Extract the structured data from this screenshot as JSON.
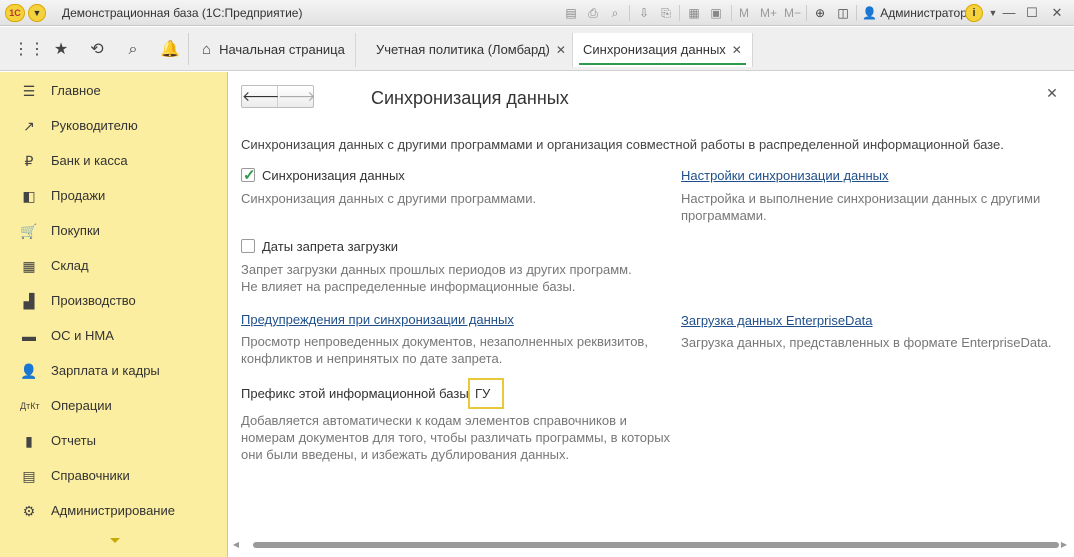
{
  "window": {
    "logo": "1С",
    "title": "Демонстрационная база  (1С:Предприятие)",
    "toolbar_m": "M",
    "toolbar_mplus": "M+",
    "toolbar_mminus": "M−",
    "user": "Администратор",
    "info": "i"
  },
  "tabs": {
    "home": "Начальная страница",
    "accounting_policy": "Учетная политика (Ломбард)",
    "sync": "Синхронизация данных"
  },
  "sidebar": {
    "items": [
      {
        "label": "Главное",
        "icon": "menu-icon"
      },
      {
        "label": "Руководителю",
        "icon": "trend-icon"
      },
      {
        "label": "Банк и касса",
        "icon": "ruble-icon"
      },
      {
        "label": "Продажи",
        "icon": "bag-icon"
      },
      {
        "label": "Покупки",
        "icon": "cart-icon"
      },
      {
        "label": "Склад",
        "icon": "warehouse-icon"
      },
      {
        "label": "Производство",
        "icon": "factory-icon"
      },
      {
        "label": "ОС и НМА",
        "icon": "assets-icon"
      },
      {
        "label": "Зарплата и кадры",
        "icon": "person-icon"
      },
      {
        "label": "Операции",
        "icon": "debit-credit-icon"
      },
      {
        "label": "Отчеты",
        "icon": "chart-icon"
      },
      {
        "label": "Справочники",
        "icon": "book-icon"
      },
      {
        "label": "Администрирование",
        "icon": "gear-icon"
      }
    ]
  },
  "form": {
    "title": "Синхронизация данных",
    "intro": "Синхронизация данных с другими программами и организация совместной работы в распределенной информационной базе.",
    "sync_checkbox": {
      "label": "Синхронизация данных",
      "checked": true,
      "desc": "Синхронизация данных с другими программами."
    },
    "settings_link": {
      "label": "Настройки синхронизации данных",
      "desc_1": "Настройка и выполнение синхронизации данных с другими",
      "desc_2": "программами."
    },
    "lock_checkbox": {
      "label": "Даты запрета загрузки",
      "checked": false,
      "desc_1": "Запрет загрузки данных прошлых периодов из других программ.",
      "desc_2": "Не влияет на распределенные информационные базы."
    },
    "warnings_link": {
      "label": "Предупреждения при синхронизации данных",
      "desc_1": "Просмотр непроведенных документов, незаполненных реквизитов,",
      "desc_2": "конфликтов и непринятых по дате запрета."
    },
    "enterprise_link": {
      "label": "Загрузка данных EnterpriseData",
      "desc": "Загрузка данных, представленных в формате EnterpriseData."
    },
    "prefix": {
      "label": "Префикс этой информационной базы:",
      "value": "ГУ",
      "desc_1": "Добавляется автоматически к кодам элементов справочников и",
      "desc_2": "номерам документов для того, чтобы различать программы, в которых",
      "desc_3": "они были введены, и избежать дублирования данных."
    }
  }
}
